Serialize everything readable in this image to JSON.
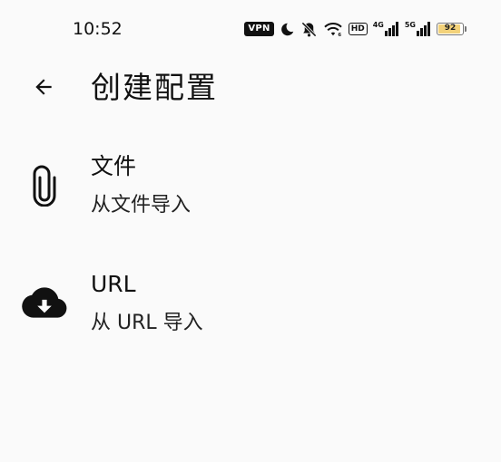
{
  "status_bar": {
    "time": "10:52",
    "vpn": "VPN",
    "hd": "HD",
    "net1": "4G",
    "net2": "5G",
    "battery": "92",
    "battery_level": 0.92,
    "icons": [
      "vpn-icon",
      "moon-icon",
      "bell-off-icon",
      "wifi-icon",
      "hd-icon",
      "signal-4g-icon",
      "signal-5g-icon",
      "battery-icon"
    ]
  },
  "app_bar": {
    "back_icon": "arrow-left-icon",
    "title": "创建配置"
  },
  "options": [
    {
      "icon": "paperclip-icon",
      "title": "文件",
      "subtitle": "从文件导入"
    },
    {
      "icon": "cloud-download-icon",
      "title": "URL",
      "subtitle": "从 URL 导入"
    }
  ]
}
